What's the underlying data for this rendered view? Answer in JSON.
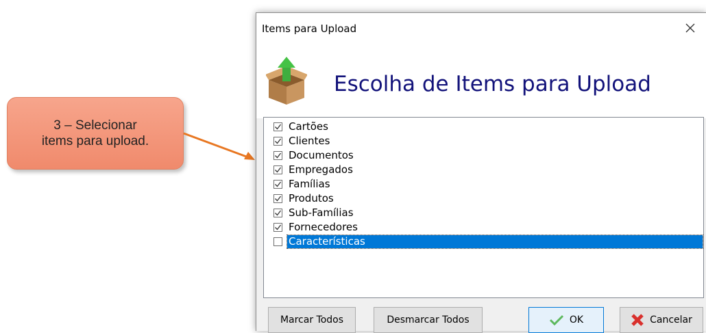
{
  "callout": {
    "line1": "3 – Selecionar",
    "line2": "items para upload."
  },
  "dialog": {
    "title": "Items para Upload",
    "close_icon": "close-icon",
    "header_icon": "upload-box-icon",
    "header_title": "Escolha de Items para Upload",
    "items": [
      {
        "label": "Cartões",
        "checked": true
      },
      {
        "label": "Clientes",
        "checked": true
      },
      {
        "label": "Documentos",
        "checked": true
      },
      {
        "label": "Empregados",
        "checked": true
      },
      {
        "label": "Famílias",
        "checked": true
      },
      {
        "label": "Produtos",
        "checked": true
      },
      {
        "label": "Sub-Famílias",
        "checked": true
      },
      {
        "label": "Fornecedores",
        "checked": true
      },
      {
        "label": "Características",
        "checked": false,
        "selected": true
      }
    ],
    "buttons": {
      "mark_all": "Marcar Todos",
      "unmark_all": "Desmarcar Todos",
      "ok": "OK",
      "cancel": "Cancelar"
    },
    "colors": {
      "header_title": "#12127a",
      "selection": "#0078d7",
      "callout_fill": "#f08a6c",
      "arrow": "#e87722"
    }
  }
}
